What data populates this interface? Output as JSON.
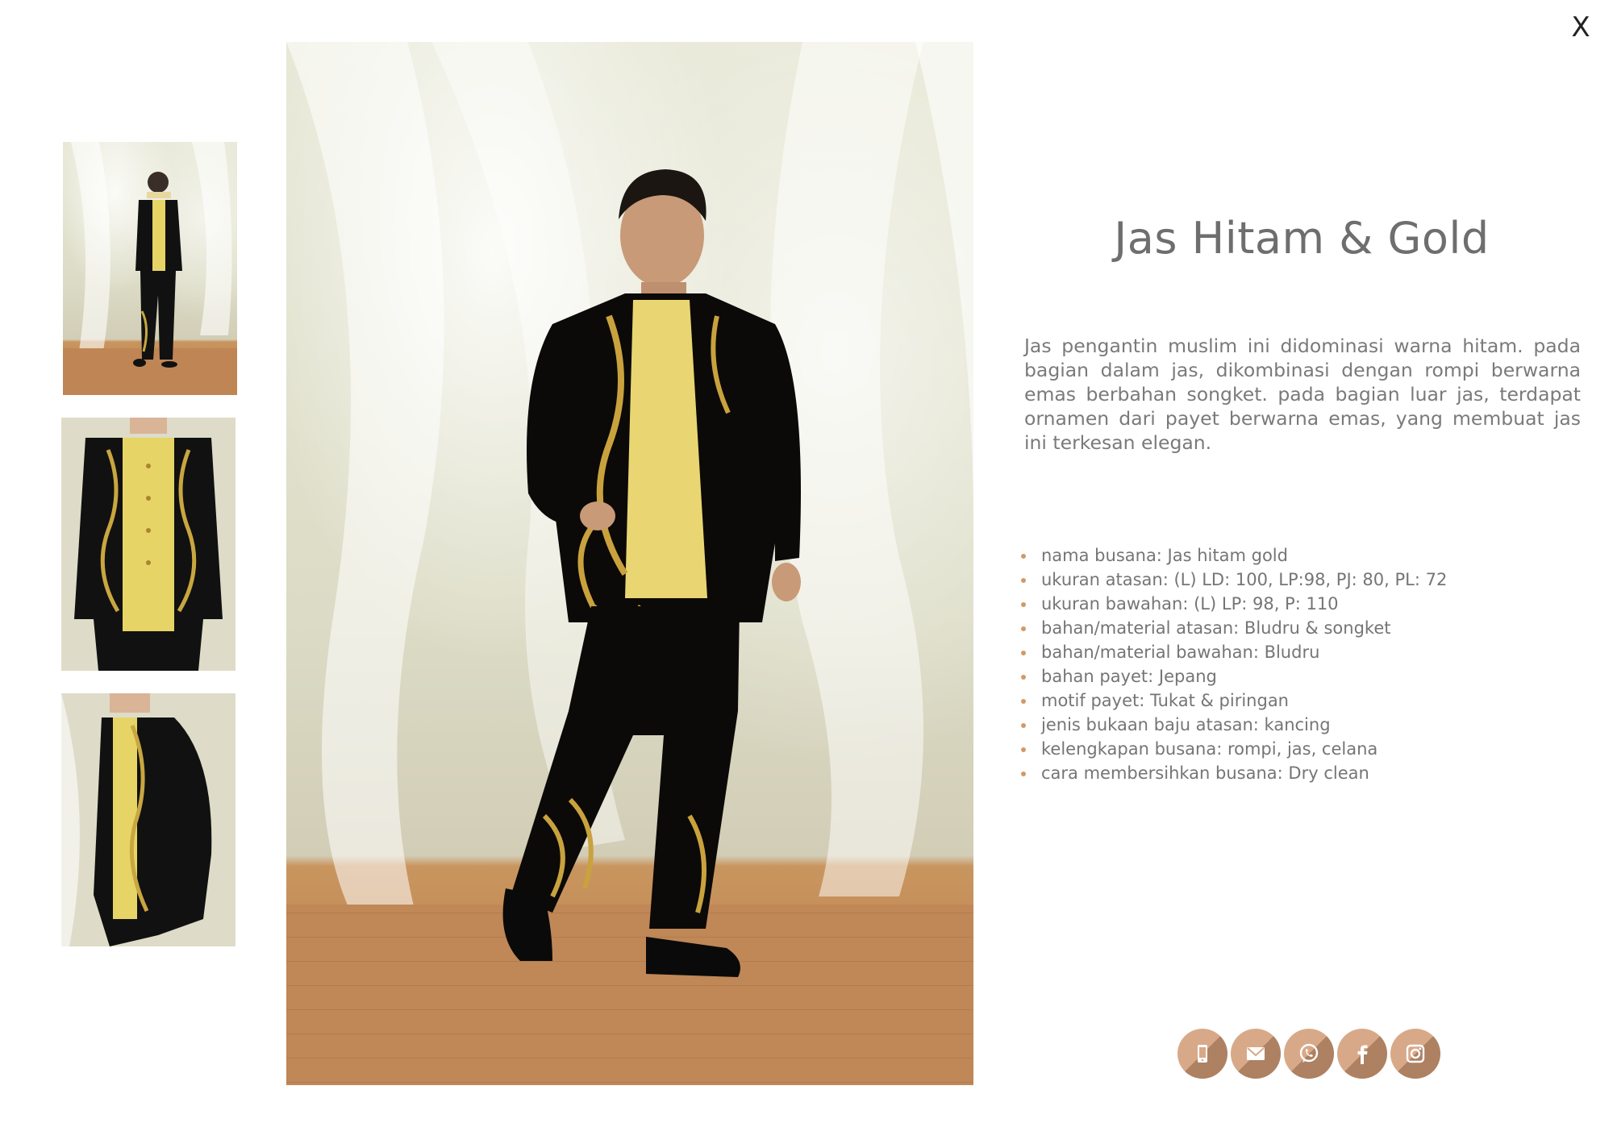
{
  "close_label": "X",
  "product": {
    "title": "Jas Hitam & Gold",
    "description": "Jas pengantin muslim ini didominasi warna hitam. pada bagian dalam jas, dikombinasi dengan rompi berwarna emas berbahan songket. pada bagian luar jas, terdapat ornamen dari payet berwarna emas, yang membuat jas ini terkesan elegan.",
    "specs": [
      "nama busana: Jas hitam gold",
      "ukuran atasan: (L) LD: 100, LP:98, PJ: 80, PL: 72",
      "ukuran bawahan: (L) LP: 98, P: 110",
      "bahan/material atasan: Bludru & songket",
      "bahan/material bawahan: Bludru",
      "bahan payet: Jepang",
      "motif payet: Tukat & piringan",
      "jenis bukaan baju atasan:  kancing",
      "kelengkapan busana: rompi, jas, celana",
      "cara membersihkan busana: Dry clean"
    ]
  },
  "gallery": {
    "thumbnails": [
      "full-body-view",
      "front-close-up-view",
      "side-view"
    ],
    "main": "full-body-view"
  },
  "social": [
    "phone-icon",
    "mail-icon",
    "whatsapp-icon",
    "facebook-icon",
    "instagram-icon"
  ],
  "colors": {
    "accent": "#d19a6a",
    "button": "#d8a989",
    "title": "#6e6e6e",
    "text": "#7a7a7a"
  }
}
